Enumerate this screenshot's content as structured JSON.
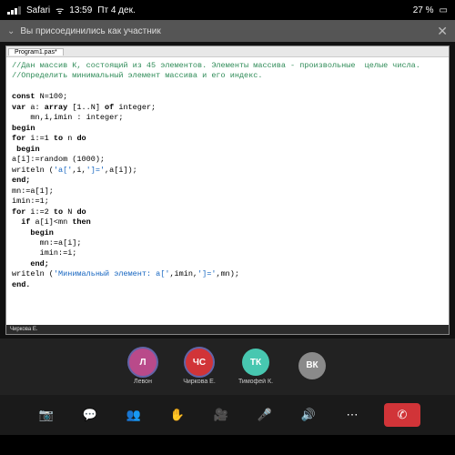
{
  "status": {
    "carrier": "Safari",
    "time": "13:59",
    "date": "Пт 4 дек.",
    "battery_pct": "27 %"
  },
  "banner": {
    "text": "Вы присоединились как участник",
    "close": "✕"
  },
  "editor": {
    "tab": "Program1.pas*",
    "status_tab": "Чиркова Е."
  },
  "code": {
    "l1": "//Дан массив К, состоящий из 45 элементов. Элементы массива - произвольные  целые числа.",
    "l2": "//Определить минимальный элемент массива и его индекс.",
    "l3_a": "const",
    "l3_b": " N=100;",
    "l4_a": "var",
    "l4_b": " a: ",
    "l4_c": "array",
    "l4_d": " [1..N] ",
    "l4_e": "of",
    "l4_f": " integer;",
    "l5": "    mn,i,imin : integer;",
    "l6": "begin",
    "l7_a": "for",
    "l7_b": " i:=1 ",
    "l7_c": "to",
    "l7_d": " n ",
    "l7_e": "do",
    "l8": " begin",
    "l9": "a[i]:=random (1000);",
    "l10_a": "writeln (",
    "l10_b": "'a['",
    "l10_c": ",i,",
    "l10_d": "']='",
    "l10_e": ",a[i]);",
    "l11": "end;",
    "l12": "mn:=a[1];",
    "l13": "imin:=1;",
    "l14_a": "for",
    "l14_b": " i:=2 ",
    "l14_c": "to",
    "l14_d": " N ",
    "l14_e": "do",
    "l15_a": "  if",
    "l15_b": " a[i]<mn ",
    "l15_c": "then",
    "l16": "    begin",
    "l17": "      mn:=a[i];",
    "l18": "      imin:=i;",
    "l19": "    end;",
    "l20_a": "writeln (",
    "l20_b": "'Минимальный элемент: a['",
    "l20_c": ",imin,",
    "l20_d": "']='",
    "l20_e": ",mn);",
    "l21": "end."
  },
  "participants": [
    {
      "initials": "Л",
      "name": "Левон",
      "color": "#b94a8a",
      "halo": true
    },
    {
      "initials": "ЧС",
      "name": "Чиркова Е.",
      "color": "#d13438",
      "halo": true
    },
    {
      "initials": "ТК",
      "name": "Тимофей К.",
      "color": "#47c7b0",
      "halo": false
    },
    {
      "initials": "ВК",
      "name": "",
      "color": "#8a8a8a",
      "halo": false
    }
  ],
  "controls": {
    "camera": "camera-icon",
    "chat": "chat-icon",
    "people": "people-icon",
    "raise": "raise-hand-icon",
    "video": "video-off-icon",
    "mic": "mic-off-icon",
    "speaker": "speaker-icon",
    "more": "more-icon",
    "hangup": "hangup-icon"
  }
}
